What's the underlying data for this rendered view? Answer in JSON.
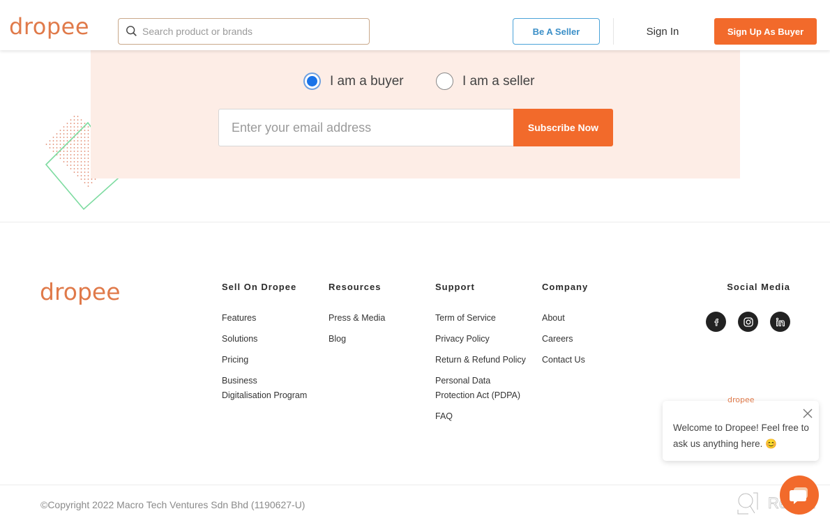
{
  "header": {
    "logo": "dropee",
    "search_placeholder": "Search product or brands",
    "be_seller_label": "Be A Seller",
    "sign_in_label": "Sign In",
    "sign_up_label": "Sign Up As Buyer"
  },
  "subscribe": {
    "radio_options": [
      {
        "label": "I am a buyer",
        "checked": true
      },
      {
        "label": "I am a seller",
        "checked": false
      }
    ],
    "email_placeholder": "Enter your email address",
    "button_label": "Subscribe Now"
  },
  "footer": {
    "logo": "dropee",
    "columns": [
      {
        "title": "Sell On Dropee",
        "links": [
          "Features",
          "Solutions",
          "Pricing",
          "Business Digitalisation Program"
        ]
      },
      {
        "title": "Resources",
        "links": [
          "Press & Media",
          "Blog"
        ]
      },
      {
        "title": "Support",
        "links": [
          "Term of Service",
          "Privacy Policy",
          "Return & Refund Policy",
          "Personal Data Protection Act (PDPA)",
          "FAQ"
        ]
      },
      {
        "title": "Company",
        "links": [
          "About",
          "Careers",
          "Contact Us"
        ]
      }
    ],
    "social": {
      "title": "Social Media",
      "icons": [
        "facebook-icon",
        "instagram-icon",
        "linkedin-icon"
      ]
    },
    "copyright": "©Copyright 2022 Macro Tech Ventures Sdn Bhd (1190627-U)"
  },
  "chat": {
    "brand": "dropee",
    "message": "Welcome to Dropee! Feel free to ask us anything here. 😊"
  },
  "watermark": "Revain",
  "colors": {
    "brand_orange": "#f26a2b",
    "logo_orange": "#e07a4a",
    "panel_bg": "#fdede6",
    "seller_blue": "#3b8fc7",
    "radio_blue": "#1a73e8"
  }
}
